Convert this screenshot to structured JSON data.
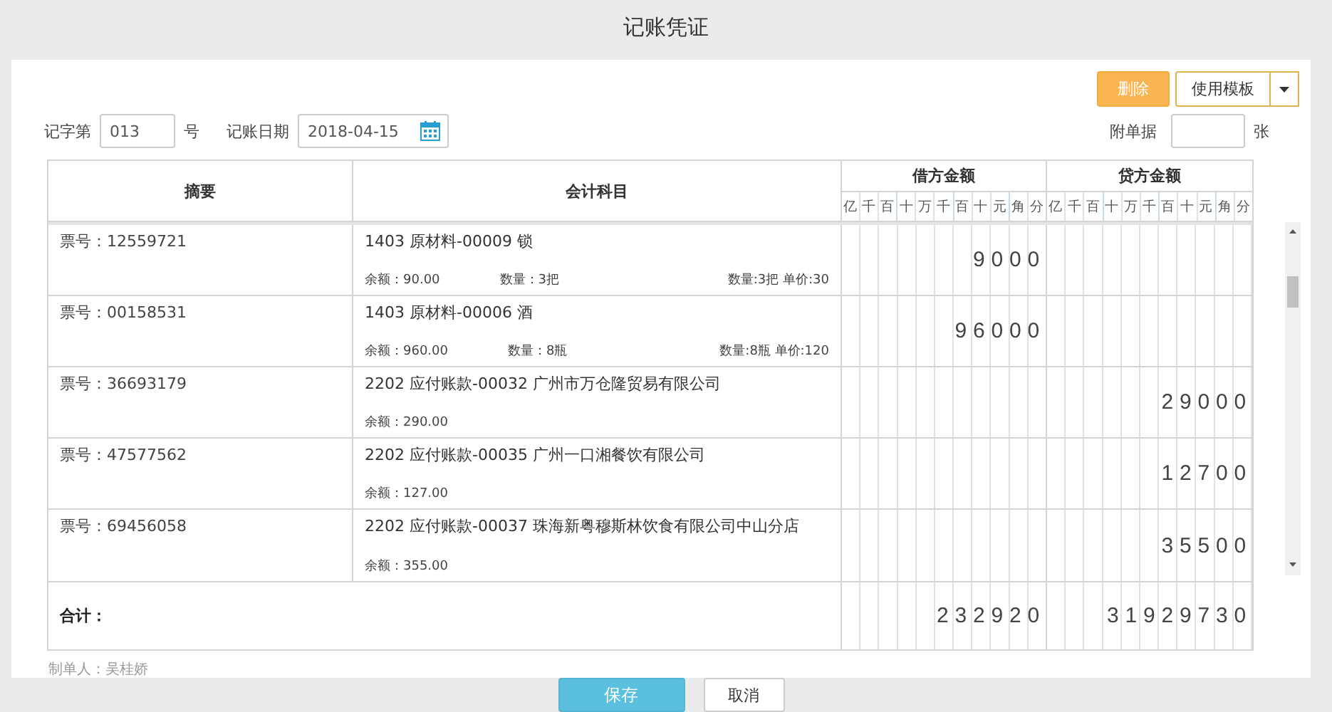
{
  "window": {
    "title": "记账凭证"
  },
  "toolbar": {
    "delete_button": "删除",
    "template_button": "使用模板"
  },
  "voucher": {
    "word_label": "记字第",
    "number": "013",
    "number_suffix": "号",
    "date_label": "记账日期",
    "date": "2018-04-15",
    "attachments_label": "附单据",
    "attachments_suffix": "张"
  },
  "table": {
    "columns": {
      "summary": "摘要",
      "account": "会计科目",
      "debit": "借方金额",
      "credit": "贷方金额"
    },
    "debit_units": [
      "亿",
      "千",
      "百",
      "十",
      "万",
      "千",
      "百",
      "十",
      "元",
      "角",
      "分"
    ],
    "credit_units": [
      "亿",
      "千",
      "百",
      "十",
      "万",
      "千",
      "百",
      "十",
      "元",
      "角",
      "分"
    ],
    "rows": [
      {
        "summary": "票号：12559721",
        "account": "1403 原材料-00009 锁",
        "balance": "余额：90.00",
        "quantity": "数量：3把",
        "note": "数量:3把 单价:30",
        "debit": "9000"
      },
      {
        "summary": "票号：00158531",
        "account": "1403 原材料-00006 酒",
        "balance": "余额：960.00",
        "quantity": "数量：8瓶",
        "note": "数量:8瓶 单价:120",
        "debit": "96000"
      },
      {
        "summary": "票号：36693179",
        "account": "2202 应付账款-00032 广州市万仓隆贸易有限公司",
        "balance": "余额：290.00",
        "credit": "29000"
      },
      {
        "summary": "票号：47577562",
        "account": "2202 应付账款-00035 广州一口湘餐饮有限公司",
        "balance": "余额：127.00",
        "credit": "12700"
      },
      {
        "summary": "票号：69456058",
        "account": "2202 应付账款-00037 珠海新粤穆斯林饮食有限公司中山分店",
        "balance": "余额：355.00",
        "credit": "35500"
      }
    ],
    "total": {
      "label": "合计：",
      "debit": "232920",
      "credit": "31929730"
    }
  },
  "footer": {
    "maker": "制单人：吴桂娇"
  },
  "actions": {
    "save": "保存",
    "cancel": "取消"
  }
}
